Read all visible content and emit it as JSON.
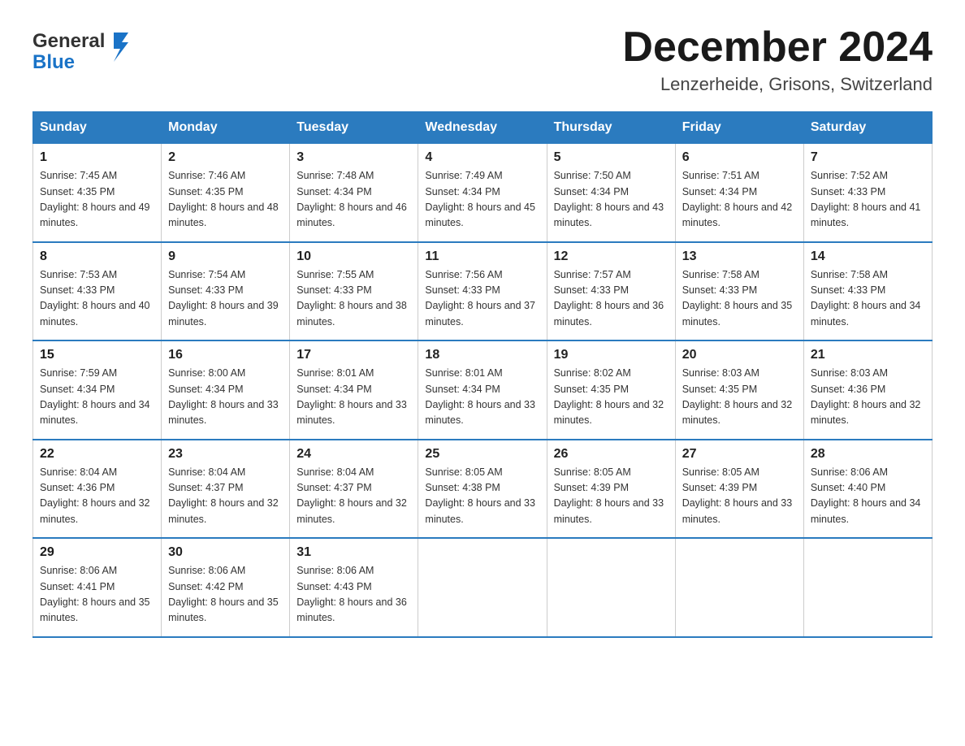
{
  "header": {
    "logo_general": "General",
    "logo_blue": "Blue",
    "month_title": "December 2024",
    "location": "Lenzerheide, Grisons, Switzerland"
  },
  "days_of_week": [
    "Sunday",
    "Monday",
    "Tuesday",
    "Wednesday",
    "Thursday",
    "Friday",
    "Saturday"
  ],
  "weeks": [
    [
      {
        "day": "1",
        "sunrise": "7:45 AM",
        "sunset": "4:35 PM",
        "daylight": "8 hours and 49 minutes."
      },
      {
        "day": "2",
        "sunrise": "7:46 AM",
        "sunset": "4:35 PM",
        "daylight": "8 hours and 48 minutes."
      },
      {
        "day": "3",
        "sunrise": "7:48 AM",
        "sunset": "4:34 PM",
        "daylight": "8 hours and 46 minutes."
      },
      {
        "day": "4",
        "sunrise": "7:49 AM",
        "sunset": "4:34 PM",
        "daylight": "8 hours and 45 minutes."
      },
      {
        "day": "5",
        "sunrise": "7:50 AM",
        "sunset": "4:34 PM",
        "daylight": "8 hours and 43 minutes."
      },
      {
        "day": "6",
        "sunrise": "7:51 AM",
        "sunset": "4:34 PM",
        "daylight": "8 hours and 42 minutes."
      },
      {
        "day": "7",
        "sunrise": "7:52 AM",
        "sunset": "4:33 PM",
        "daylight": "8 hours and 41 minutes."
      }
    ],
    [
      {
        "day": "8",
        "sunrise": "7:53 AM",
        "sunset": "4:33 PM",
        "daylight": "8 hours and 40 minutes."
      },
      {
        "day": "9",
        "sunrise": "7:54 AM",
        "sunset": "4:33 PM",
        "daylight": "8 hours and 39 minutes."
      },
      {
        "day": "10",
        "sunrise": "7:55 AM",
        "sunset": "4:33 PM",
        "daylight": "8 hours and 38 minutes."
      },
      {
        "day": "11",
        "sunrise": "7:56 AM",
        "sunset": "4:33 PM",
        "daylight": "8 hours and 37 minutes."
      },
      {
        "day": "12",
        "sunrise": "7:57 AM",
        "sunset": "4:33 PM",
        "daylight": "8 hours and 36 minutes."
      },
      {
        "day": "13",
        "sunrise": "7:58 AM",
        "sunset": "4:33 PM",
        "daylight": "8 hours and 35 minutes."
      },
      {
        "day": "14",
        "sunrise": "7:58 AM",
        "sunset": "4:33 PM",
        "daylight": "8 hours and 34 minutes."
      }
    ],
    [
      {
        "day": "15",
        "sunrise": "7:59 AM",
        "sunset": "4:34 PM",
        "daylight": "8 hours and 34 minutes."
      },
      {
        "day": "16",
        "sunrise": "8:00 AM",
        "sunset": "4:34 PM",
        "daylight": "8 hours and 33 minutes."
      },
      {
        "day": "17",
        "sunrise": "8:01 AM",
        "sunset": "4:34 PM",
        "daylight": "8 hours and 33 minutes."
      },
      {
        "day": "18",
        "sunrise": "8:01 AM",
        "sunset": "4:34 PM",
        "daylight": "8 hours and 33 minutes."
      },
      {
        "day": "19",
        "sunrise": "8:02 AM",
        "sunset": "4:35 PM",
        "daylight": "8 hours and 32 minutes."
      },
      {
        "day": "20",
        "sunrise": "8:03 AM",
        "sunset": "4:35 PM",
        "daylight": "8 hours and 32 minutes."
      },
      {
        "day": "21",
        "sunrise": "8:03 AM",
        "sunset": "4:36 PM",
        "daylight": "8 hours and 32 minutes."
      }
    ],
    [
      {
        "day": "22",
        "sunrise": "8:04 AM",
        "sunset": "4:36 PM",
        "daylight": "8 hours and 32 minutes."
      },
      {
        "day": "23",
        "sunrise": "8:04 AM",
        "sunset": "4:37 PM",
        "daylight": "8 hours and 32 minutes."
      },
      {
        "day": "24",
        "sunrise": "8:04 AM",
        "sunset": "4:37 PM",
        "daylight": "8 hours and 32 minutes."
      },
      {
        "day": "25",
        "sunrise": "8:05 AM",
        "sunset": "4:38 PM",
        "daylight": "8 hours and 33 minutes."
      },
      {
        "day": "26",
        "sunrise": "8:05 AM",
        "sunset": "4:39 PM",
        "daylight": "8 hours and 33 minutes."
      },
      {
        "day": "27",
        "sunrise": "8:05 AM",
        "sunset": "4:39 PM",
        "daylight": "8 hours and 33 minutes."
      },
      {
        "day": "28",
        "sunrise": "8:06 AM",
        "sunset": "4:40 PM",
        "daylight": "8 hours and 34 minutes."
      }
    ],
    [
      {
        "day": "29",
        "sunrise": "8:06 AM",
        "sunset": "4:41 PM",
        "daylight": "8 hours and 35 minutes."
      },
      {
        "day": "30",
        "sunrise": "8:06 AM",
        "sunset": "4:42 PM",
        "daylight": "8 hours and 35 minutes."
      },
      {
        "day": "31",
        "sunrise": "8:06 AM",
        "sunset": "4:43 PM",
        "daylight": "8 hours and 36 minutes."
      },
      null,
      null,
      null,
      null
    ]
  ]
}
